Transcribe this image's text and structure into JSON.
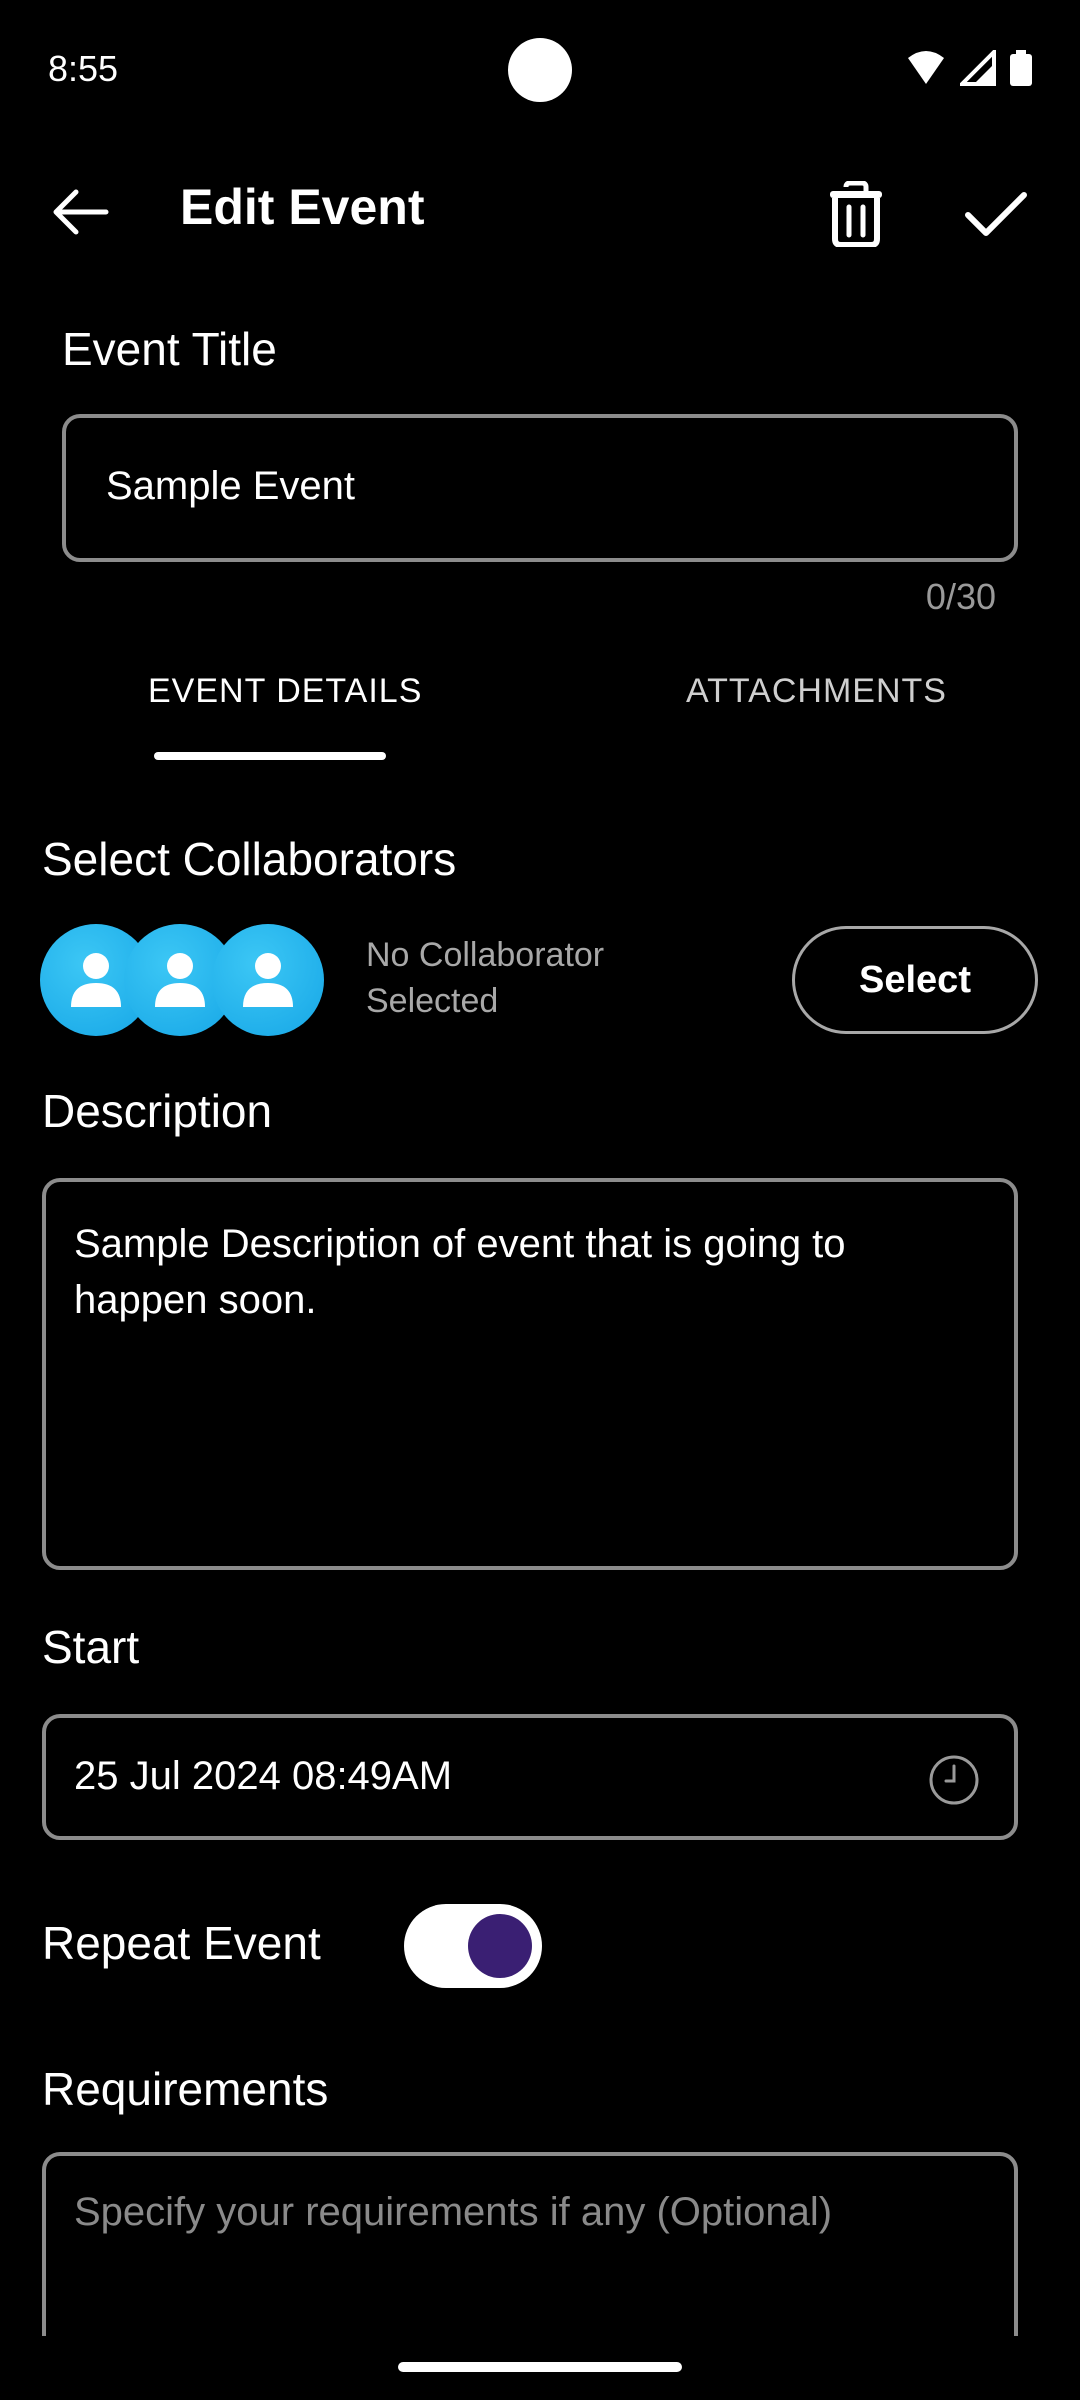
{
  "status_bar": {
    "time": "8:55"
  },
  "app_bar": {
    "title": "Edit Event"
  },
  "event_title": {
    "label": "Event Title",
    "value": "Sample Event",
    "counter": "0/30"
  },
  "tabs": [
    {
      "label": "EVENT DETAILS",
      "active": true
    },
    {
      "label": "ATTACHMENTS",
      "active": false
    }
  ],
  "collaborators": {
    "label": "Select Collaborators",
    "status_line1": "No Collaborator",
    "status_line2": "Selected",
    "button_label": "Select"
  },
  "description": {
    "label": "Description",
    "value": "Sample Description of event that is going to happen soon."
  },
  "start": {
    "label": "Start",
    "value": "25 Jul 2024 08:49AM"
  },
  "repeat": {
    "label": "Repeat Event",
    "enabled": true
  },
  "requirements": {
    "label": "Requirements",
    "placeholder": "Specify your requirements if any (Optional)"
  },
  "colors": {
    "background": "#000000",
    "avatar": "#1AA9E8",
    "toggle_knob": "#3A1F73",
    "outline": "#8C8C8C"
  }
}
